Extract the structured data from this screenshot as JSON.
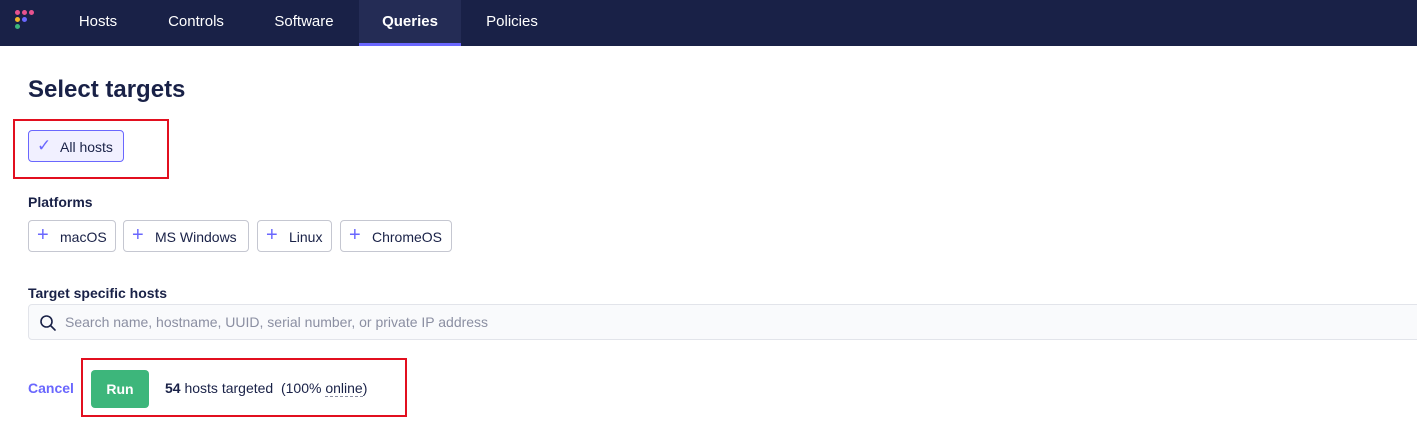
{
  "nav": {
    "items": [
      {
        "label": "Hosts",
        "active": false
      },
      {
        "label": "Controls",
        "active": false
      },
      {
        "label": "Software",
        "active": false
      },
      {
        "label": "Queries",
        "active": true
      },
      {
        "label": "Policies",
        "active": false
      }
    ]
  },
  "page": {
    "title": "Select targets",
    "all_hosts_label": "All hosts",
    "all_hosts_selected": true
  },
  "platforms": {
    "label": "Platforms",
    "items": [
      {
        "label": "macOS",
        "icon": "plus-icon"
      },
      {
        "label": "MS Windows",
        "icon": "plus-icon"
      },
      {
        "label": "Linux",
        "icon": "plus-icon"
      },
      {
        "label": "ChromeOS",
        "icon": "plus-icon"
      }
    ]
  },
  "target_hosts": {
    "label": "Target specific hosts",
    "placeholder": "Search name, hostname, UUID, serial number, or private IP address",
    "value": ""
  },
  "footer": {
    "cancel_label": "Cancel",
    "run_label": "Run",
    "host_count": "54",
    "hosts_text": "hosts targeted",
    "online_prefix": "(100%",
    "online_label": "online",
    "online_suffix": ")"
  },
  "colors": {
    "nav_bg": "#192147",
    "accent": "#6a67fe",
    "run_green": "#3db67b",
    "highlight_red": "#e20f1f"
  }
}
